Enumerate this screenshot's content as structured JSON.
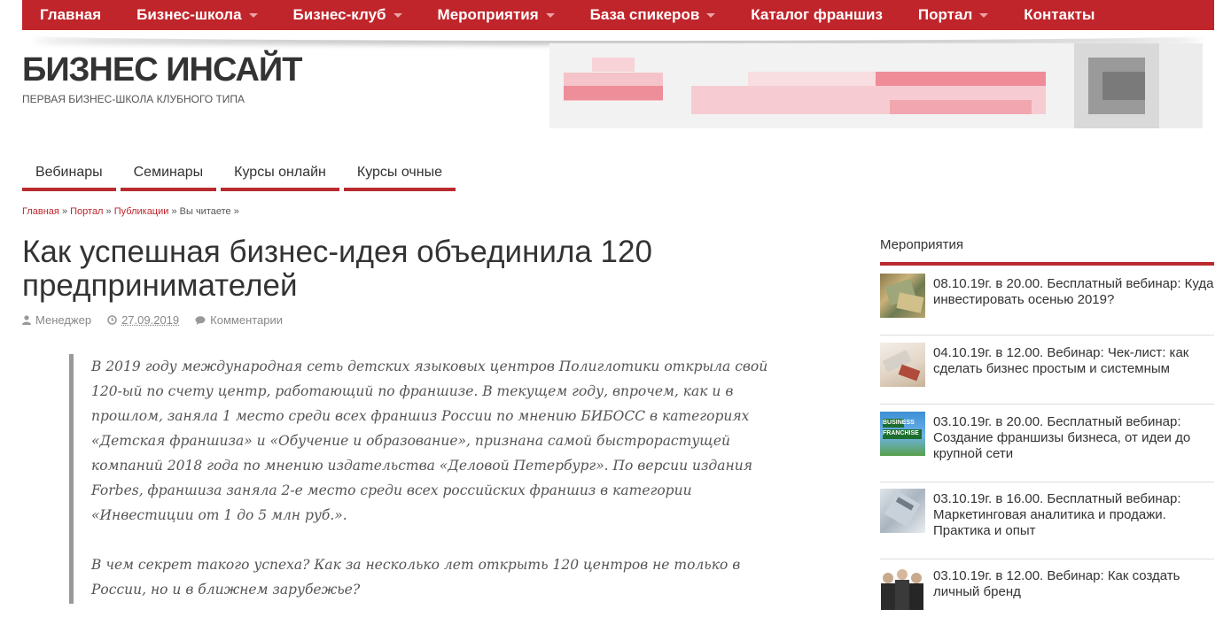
{
  "nav": {
    "items": [
      {
        "label": "Главная",
        "caret": false
      },
      {
        "label": "Бизнес-школа",
        "caret": true
      },
      {
        "label": "Бизнес-клуб",
        "caret": true
      },
      {
        "label": "Мероприятия",
        "caret": true
      },
      {
        "label": "База спикеров",
        "caret": true
      },
      {
        "label": "Каталог франшиз",
        "caret": false
      },
      {
        "label": "Портал",
        "caret": true
      },
      {
        "label": "Контакты",
        "caret": false
      }
    ]
  },
  "site": {
    "title": "БИЗНЕС ИНСАЙТ",
    "tagline": "ПЕРВАЯ БИЗНЕС-ШКОЛА КЛУБНОГО ТИПА"
  },
  "subnav": {
    "tabs": [
      "Вебинары",
      "Семинары",
      "Курсы онлайн",
      "Курсы очные"
    ]
  },
  "breadcrumb": {
    "items": [
      "Главная",
      "Портал",
      "Публикации"
    ],
    "separator": "»",
    "current": "Вы читаете »"
  },
  "article": {
    "title": "Как успешная бизнес-идея объединила 120 предпринимателей",
    "author": "Менеджер",
    "date": "27.09.2019",
    "comments": "Комментарии",
    "paragraphs": [
      "В 2019 году международная сеть детских языковых центров Полиглотики открыла свой 120-ый по счету центр, работающий по франшизе. В текущем году, впрочем, как и в прошлом, заняла 1 место среди всех франшиз России по мнению БИБОСС в категориях «Детская франшиза» и «Обучение и образование», признана самой быстрорастущей компаний 2018 года по мнению издательства «Деловой Петербург». По версии издания Forbes, франшиза заняла 2-е место среди всех российских франшиз в категории «Инвестиции от 1 до 5 млн руб.».",
      "В чем секрет такого успеха? Как за несколько лет открыть 120 центров не только в России, но и в ближнем зарубежье?"
    ]
  },
  "sidebar": {
    "title": "Мероприятия",
    "events": [
      {
        "text": "08.10.19г. в 20.00. Бесплатный вебинар: Куда инвестировать осенью 2019?",
        "thumb": "money-photo"
      },
      {
        "text": "04.10.19г. в 12.00. Вебинар: Чек-лист: как сделать бизнес простым и системным",
        "thumb": "desk-photo"
      },
      {
        "text": "03.10.19г. в 20.00. Бесплатный вебинар: Создание франшизы бизнеса, от идеи до крупной сети",
        "thumb": "franchise-sign-photo",
        "thumb_text": "BUSINESS FRANCHISE"
      },
      {
        "text": "03.10.19г. в 16.00. Бесплатный вебинар: Маркетинговая аналитика и продажи. Практика и опыт",
        "thumb": "analytics-photo"
      },
      {
        "text": "03.10.19г. в 12.00. Вебинар: Как создать личный бренд",
        "thumb": "people-photo"
      }
    ]
  },
  "colors": {
    "brand_red": "#c0252b",
    "underline_red": "#b82b2e",
    "text_dark": "#333333",
    "quote_bar": "#999999"
  }
}
